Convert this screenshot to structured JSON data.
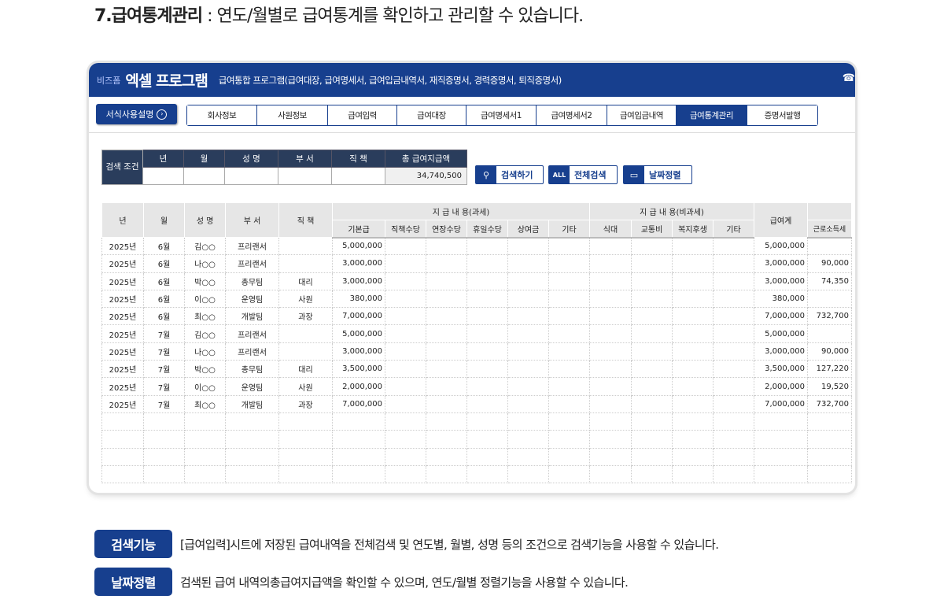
{
  "heading": {
    "title": "7.급여통계관리",
    "desc": " : 연도/월별로 급여통계를 확인하고 관리할 수 있습니다."
  },
  "app": {
    "brand_small": "비즈폼",
    "brand": "엑셀 프로그램",
    "subtitle": "급여통합 프로그램(급여대장, 급여명세서, 급여입금내역서, 재직증명서, 경력증명서, 퇴직증명서)",
    "phone_icon": "phone-icon"
  },
  "nav": {
    "manual": "서식사용설명",
    "tabs": [
      "회사정보",
      "사원정보",
      "급여입력",
      "급여대장",
      "급여명세서1",
      "급여명세서2",
      "급여입금내역",
      "급여통계관리",
      "증명서발행"
    ],
    "active": "급여통계관리"
  },
  "search": {
    "label": "검색 조건",
    "headers": [
      "년",
      "월",
      "성 명",
      "부 서",
      "직 책",
      "총 급여지급액"
    ],
    "total": "34,740,500",
    "buttons": [
      "검색하기",
      "전체검색",
      "날짜정렬"
    ]
  },
  "table": {
    "top_headers": [
      "년",
      "월",
      "성 명",
      "부 서",
      "직 책",
      "지 급 내 용(과세)",
      "지 급 내 용(비과세)",
      "급여계"
    ],
    "taxable": [
      "기본급",
      "직책수당",
      "연장수당",
      "휴일수당",
      "상여금",
      "기타"
    ],
    "nontaxable": [
      "식대",
      "교통비",
      "복지후생",
      "기타"
    ],
    "tax": "근로소득세",
    "rows": [
      [
        "2025년",
        "6월",
        "김○○",
        "프리랜서",
        "",
        "5,000,000",
        "5,000,000",
        ""
      ],
      [
        "2025년",
        "6월",
        "나○○",
        "프리랜서",
        "",
        "3,000,000",
        "3,000,000",
        "90,000"
      ],
      [
        "2025년",
        "6월",
        "박○○",
        "총무팀",
        "대리",
        "3,000,000",
        "3,000,000",
        "74,350"
      ],
      [
        "2025년",
        "6월",
        "이○○",
        "운영팀",
        "사원",
        "380,000",
        "380,000",
        ""
      ],
      [
        "2025년",
        "6월",
        "최○○",
        "개발팀",
        "과장",
        "7,000,000",
        "7,000,000",
        "732,700"
      ],
      [
        "2025년",
        "7월",
        "김○○",
        "프리랜서",
        "",
        "5,000,000",
        "5,000,000",
        ""
      ],
      [
        "2025년",
        "7월",
        "나○○",
        "프리랜서",
        "",
        "3,000,000",
        "3,000,000",
        "90,000"
      ],
      [
        "2025년",
        "7월",
        "박○○",
        "총무팀",
        "대리",
        "3,500,000",
        "3,500,000",
        "127,220"
      ],
      [
        "2025년",
        "7월",
        "이○○",
        "운영팀",
        "사원",
        "2,000,000",
        "2,000,000",
        "19,520"
      ],
      [
        "2025년",
        "7월",
        "최○○",
        "개발팀",
        "과장",
        "7,000,000",
        "7,000,000",
        "732,700"
      ]
    ]
  },
  "features": [
    {
      "badge": "검색기능",
      "text": "[급여입력]시트에 저장된 급여내역을 전체검색 및 연도별, 월별, 성명 등의 조건으로 검색기능을 사용할 수 있습니다."
    },
    {
      "badge": "날짜정렬",
      "text": "검색된 급여 내역의총급여지급액을 확인할 수 있으며, 연도/월별 정렬기능을 사용할 수 있습니다."
    }
  ],
  "colors": {
    "primary": "#173f8e",
    "header_dark": "#2a3d5c"
  }
}
